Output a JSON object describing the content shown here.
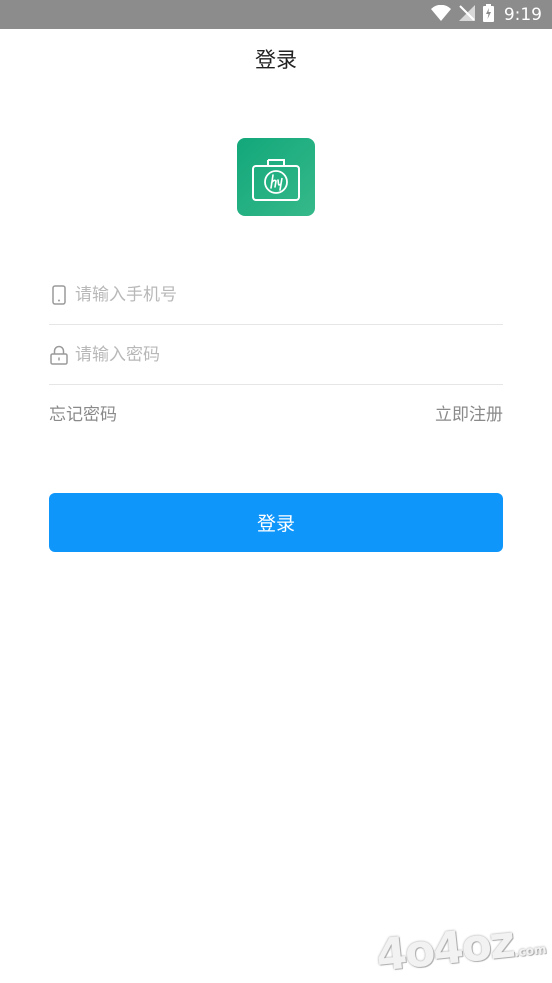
{
  "status_bar": {
    "time": "9:19",
    "icons": [
      "wifi-icon",
      "no-signal-icon",
      "battery-charging-icon"
    ]
  },
  "header": {
    "title": "登录"
  },
  "form": {
    "phone_placeholder": "请输入手机号",
    "password_placeholder": "请输入密码",
    "forgot_password": "忘记密码",
    "register": "立即注册",
    "submit_label": "登录"
  },
  "colors": {
    "status_bar": "#8c8c8c",
    "logo": "#1aa87a",
    "primary_button": "#0f96fb"
  },
  "watermark": {
    "main": "4o4oz",
    "suffix": ".com"
  }
}
